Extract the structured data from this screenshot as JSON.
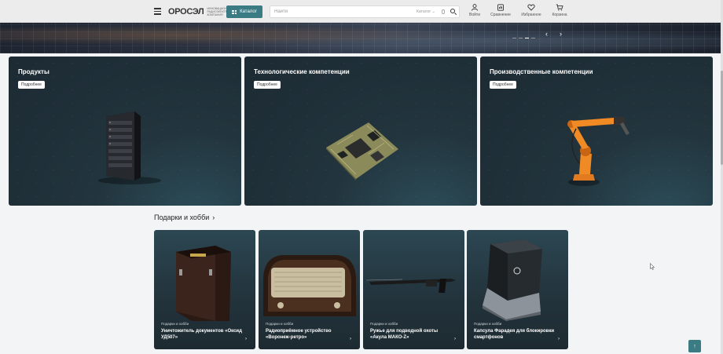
{
  "header": {
    "logo_text": "ОРОСЭЛ",
    "logo_subtitle": "ИННОВАЦИОННАЯ РАДИОЭЛЕКТРОННАЯ КОМПАНИЯ",
    "catalog_label": "Каталог",
    "search_placeholder": "Найти",
    "search_scope": "Каталог",
    "nav": {
      "login": "Войти",
      "compare": "Сравнение",
      "favorites": "Избранное",
      "cart": "Корзина"
    }
  },
  "banner": {
    "prev_icon": "chevron-left-icon",
    "next_icon": "chevron-right-icon"
  },
  "categories": [
    {
      "title": "Продукты",
      "more_label": "Подробнее"
    },
    {
      "title": "Технологические компетенции",
      "more_label": "Подробнее"
    },
    {
      "title": "Производственные компетенции",
      "more_label": "Подробнее"
    }
  ],
  "gifts": {
    "title": "Подарки и хобби",
    "items": [
      {
        "category": "Подарки и хобби",
        "name": "Уничтожитель документов «Оксид УД507»"
      },
      {
        "category": "Подарки и хобби",
        "name": "Радиоприёмное устройство «Воронеж-ретро»"
      },
      {
        "category": "Подарки и хобби",
        "name": "Ружье для подводной охоты «Акула МАКО-Z»"
      },
      {
        "category": "Подарки и хобби",
        "name": "Капсула Фарадея для блокировки смартфонов"
      }
    ]
  },
  "colors": {
    "accent": "#3b7b84",
    "card_dark": "#22343d",
    "page_bg": "#f3f4f6"
  }
}
